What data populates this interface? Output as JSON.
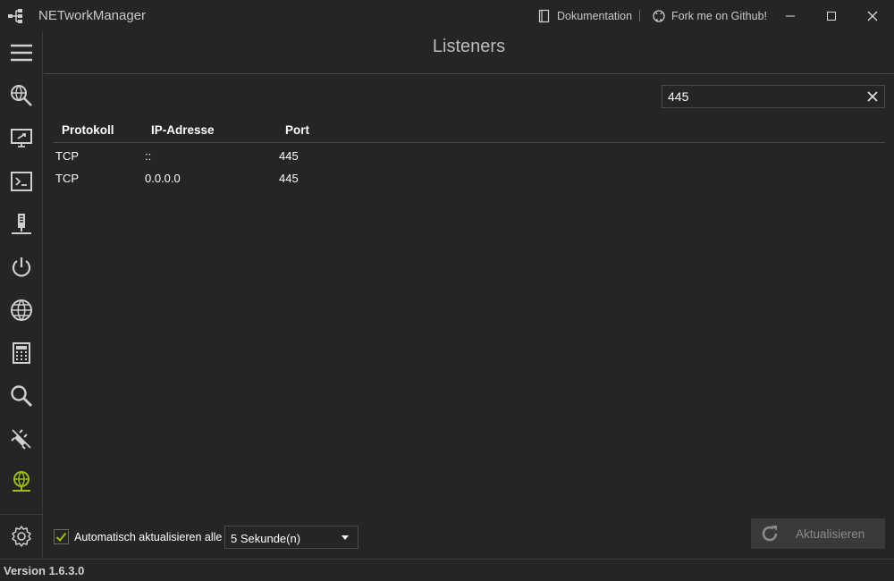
{
  "window": {
    "title": "NETworkManager",
    "links": {
      "documentation": "Dokumentation",
      "github": "Fork me on Github!"
    }
  },
  "sidebar": {
    "items": [
      {
        "icon": "hamburger-menu-icon"
      },
      {
        "icon": "network-scan-icon"
      },
      {
        "icon": "remote-desktop-icon"
      },
      {
        "icon": "terminal-icon"
      },
      {
        "icon": "server-icon"
      },
      {
        "icon": "power-icon"
      },
      {
        "icon": "globe-icon"
      },
      {
        "icon": "calculator-icon"
      },
      {
        "icon": "search-icon"
      },
      {
        "icon": "plug-off-icon"
      },
      {
        "icon": "listeners-icon",
        "active": true
      },
      {
        "icon": "gear-icon"
      }
    ],
    "active_color": "#9cbe0c"
  },
  "view": {
    "title": "Listeners"
  },
  "search": {
    "value": "445",
    "placeholder": ""
  },
  "table": {
    "columns": [
      "Protokoll",
      "IP-Adresse",
      "Port"
    ],
    "rows": [
      [
        "TCP",
        "::",
        "445"
      ],
      [
        "TCP",
        "0.0.0.0",
        "445"
      ]
    ]
  },
  "footer": {
    "auto_refresh_label": "Automatisch aktualisieren alle",
    "auto_refresh_checked": true,
    "interval_value": "5 Sekunde(n)",
    "refresh_label": "Aktualisieren"
  },
  "status": {
    "version": "Version 1.6.3.0"
  }
}
